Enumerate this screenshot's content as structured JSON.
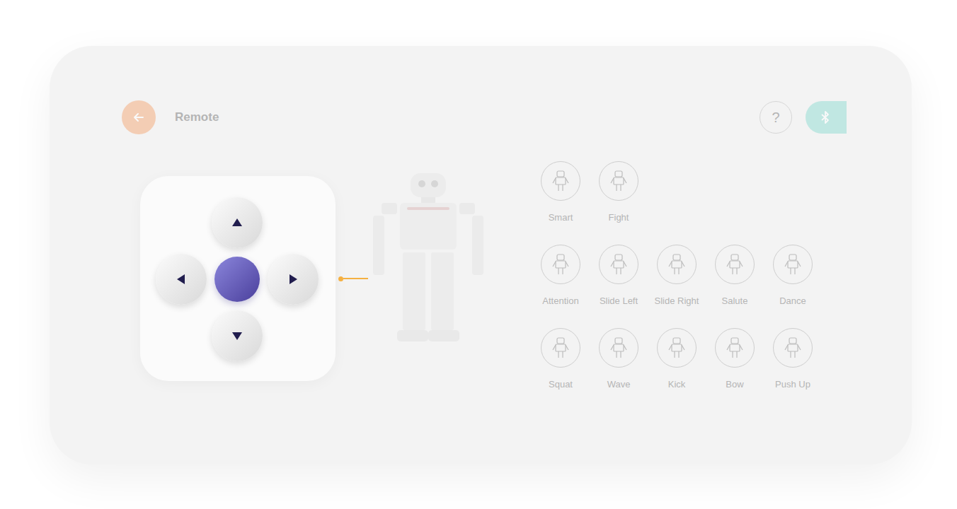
{
  "screen": {
    "title": "Remote",
    "help": "?"
  },
  "bluetooth": {
    "connected": true
  },
  "dpad": {
    "highlighted": true
  },
  "action_rows": [
    {
      "actions": [
        {
          "label": "Smart"
        },
        {
          "label": "Fight"
        }
      ]
    },
    {
      "actions": [
        {
          "label": "Attention"
        },
        {
          "label": "Slide Left"
        },
        {
          "label": "Slide Right"
        },
        {
          "label": "Salute"
        },
        {
          "label": "Dance"
        }
      ]
    },
    {
      "actions": [
        {
          "label": "Squat"
        },
        {
          "label": "Wave"
        },
        {
          "label": "Kick"
        },
        {
          "label": "Bow"
        },
        {
          "label": "Push Up"
        }
      ]
    }
  ]
}
